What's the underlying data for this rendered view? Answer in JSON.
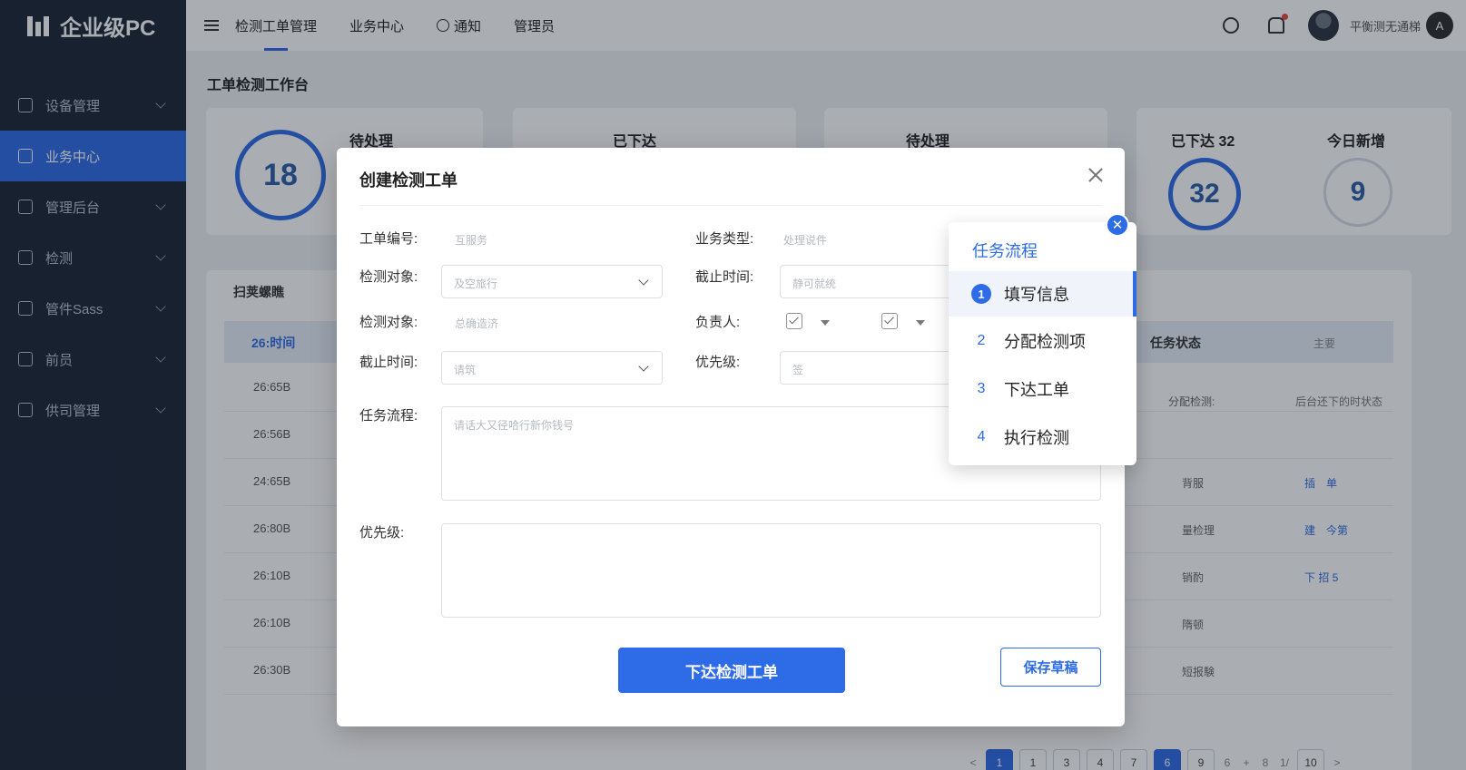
{
  "app": {
    "name": "企业级PC"
  },
  "sidebar": {
    "items": [
      {
        "label": "设备管理"
      },
      {
        "label": "业务中心"
      },
      {
        "label": "管理后台"
      },
      {
        "label": "检测"
      },
      {
        "label": "管件Sass"
      },
      {
        "label": "前员"
      },
      {
        "label": "供司管理"
      }
    ]
  },
  "topbar": {
    "nav": [
      "检测工单管理",
      "业务中心",
      "通知",
      "管理员"
    ],
    "username": "平衡测无通梯"
  },
  "page": {
    "title": "工单检测工作台",
    "stats": [
      {
        "label": "待处理",
        "value": "18"
      },
      {
        "label": "已下达"
      },
      {
        "label": "待处理"
      },
      {
        "label": "已下达 32",
        "value": "32"
      },
      {
        "label": "今日新增",
        "value": "9"
      }
    ],
    "list": {
      "title": "扫荚螺瞧",
      "headers": {
        "time": "26:时间",
        "status": "任务状态",
        "main": "主要"
      },
      "status_sub": [
        "分配检测:",
        "后台还下的时状态"
      ],
      "rows": [
        {
          "time": "26:65B",
          "status": "",
          "op": ""
        },
        {
          "time": "26:56B",
          "status": "",
          "op": ""
        },
        {
          "time": "24:65B",
          "status": "背服",
          "op": "插　单"
        },
        {
          "time": "26:80B",
          "status": "量检理",
          "op": "建　今第"
        },
        {
          "time": "26:10B",
          "status": "销酌",
          "op": "下 招 5"
        },
        {
          "time": "26:10B",
          "status": "隋顿",
          "op": ""
        },
        {
          "time": "26:30B",
          "status": "短报験",
          "op": ""
        }
      ]
    },
    "pagination": [
      "<",
      "1",
      "1",
      "3",
      "4",
      "7",
      "6",
      "9",
      "6",
      "+",
      "8",
      "1/",
      "10",
      ">"
    ]
  },
  "modal": {
    "title": "创建检测工单",
    "fields": {
      "order_no_label": "工单编号:",
      "order_no_value": "互服务",
      "biz_type_label": "业务类型:",
      "biz_type_value": "处理说件",
      "target_label": "检测对象:",
      "target_placeholder": "及空旅行",
      "deadline_label": "截止时间:",
      "deadline_placeholder": "静可就统",
      "target2_label": "检测对象:",
      "target2_value": "总确造济",
      "owner_label": "负责人:",
      "deadline2_label": "截止时间:",
      "deadline2_placeholder": "请筑",
      "priority_label": "优先级:",
      "priority_placeholder": "签",
      "flow_label": "任务流程:",
      "flow_placeholder": "请话大又径哈行新你钱号",
      "priority2_label": "优先级:"
    },
    "submit_label": "下达检测工单",
    "draft_label": "保存草稿"
  },
  "flow_panel": {
    "title": "任务流程",
    "close_glyph": "✕",
    "steps": [
      {
        "num": "1",
        "label": "填写信息"
      },
      {
        "num": "2",
        "label": "分配检测项"
      },
      {
        "num": "3",
        "label": "下达工单"
      },
      {
        "num": "4",
        "label": "执行检测"
      }
    ]
  },
  "colors": {
    "accent": "#2e6be6",
    "sidebar_bg": "#1a2436"
  }
}
